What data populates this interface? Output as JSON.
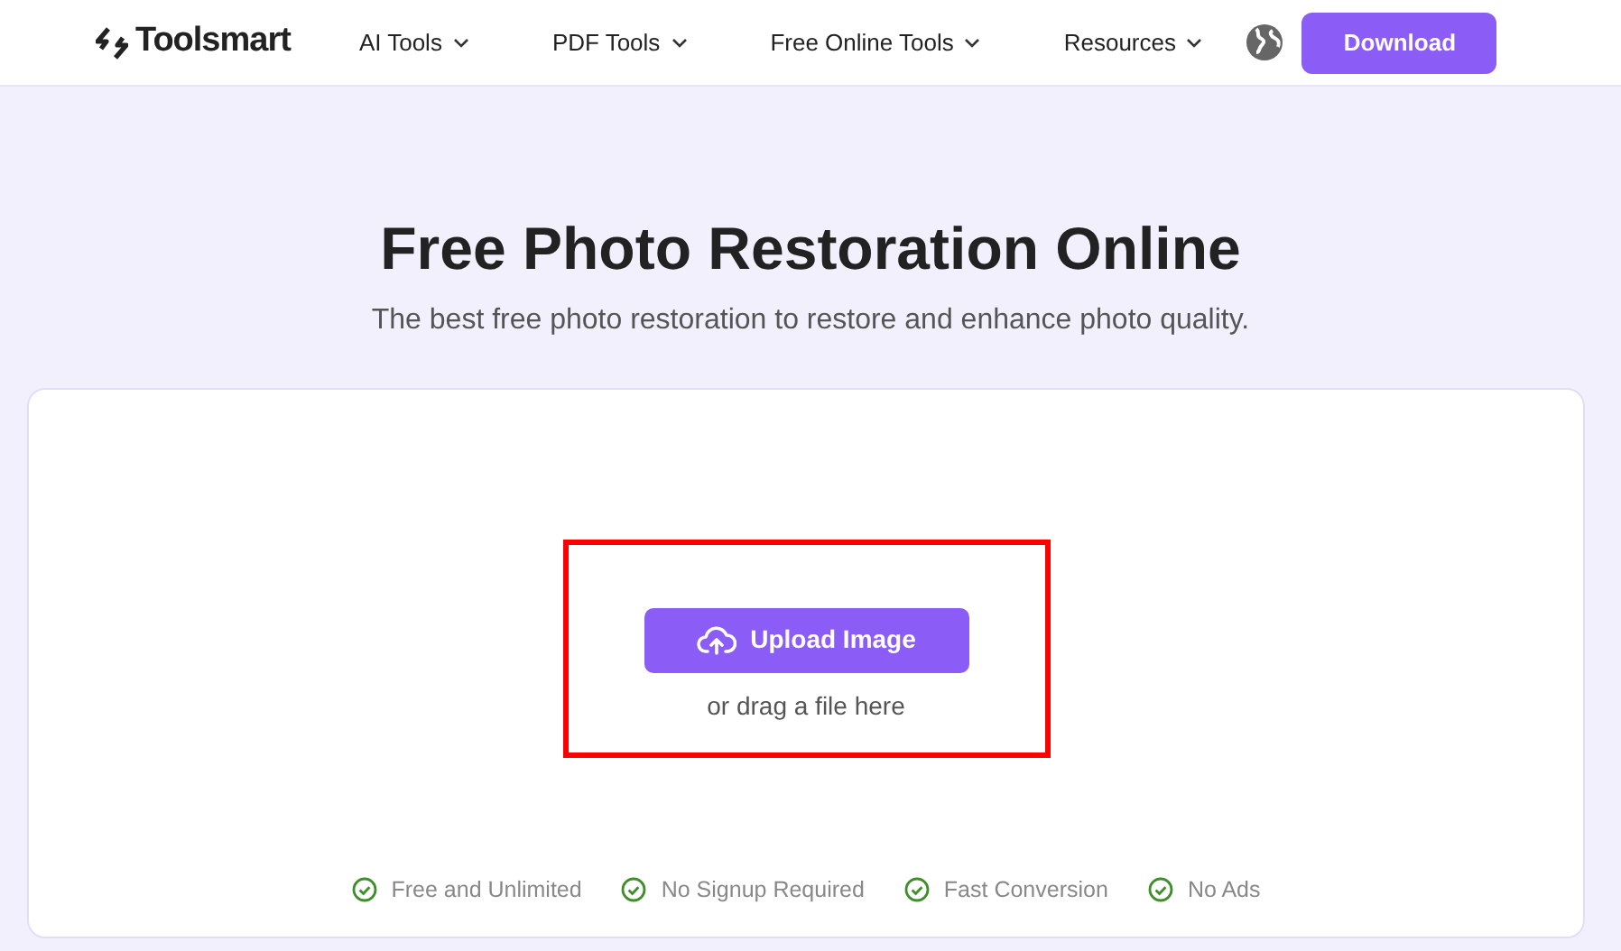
{
  "header": {
    "logo": "Toolsmart",
    "nav": [
      {
        "label": "AI Tools"
      },
      {
        "label": "PDF Tools"
      },
      {
        "label": "Free Online Tools"
      },
      {
        "label": "Resources"
      }
    ],
    "download": "Download"
  },
  "hero": {
    "title": "Free Photo Restoration Online",
    "subtitle": "The best free photo restoration to restore and enhance photo quality."
  },
  "upload": {
    "button": "Upload Image",
    "hint": "or drag a file here"
  },
  "features": [
    "Free and Unlimited",
    "No Signup Required",
    "Fast Conversion",
    "No Ads"
  ]
}
